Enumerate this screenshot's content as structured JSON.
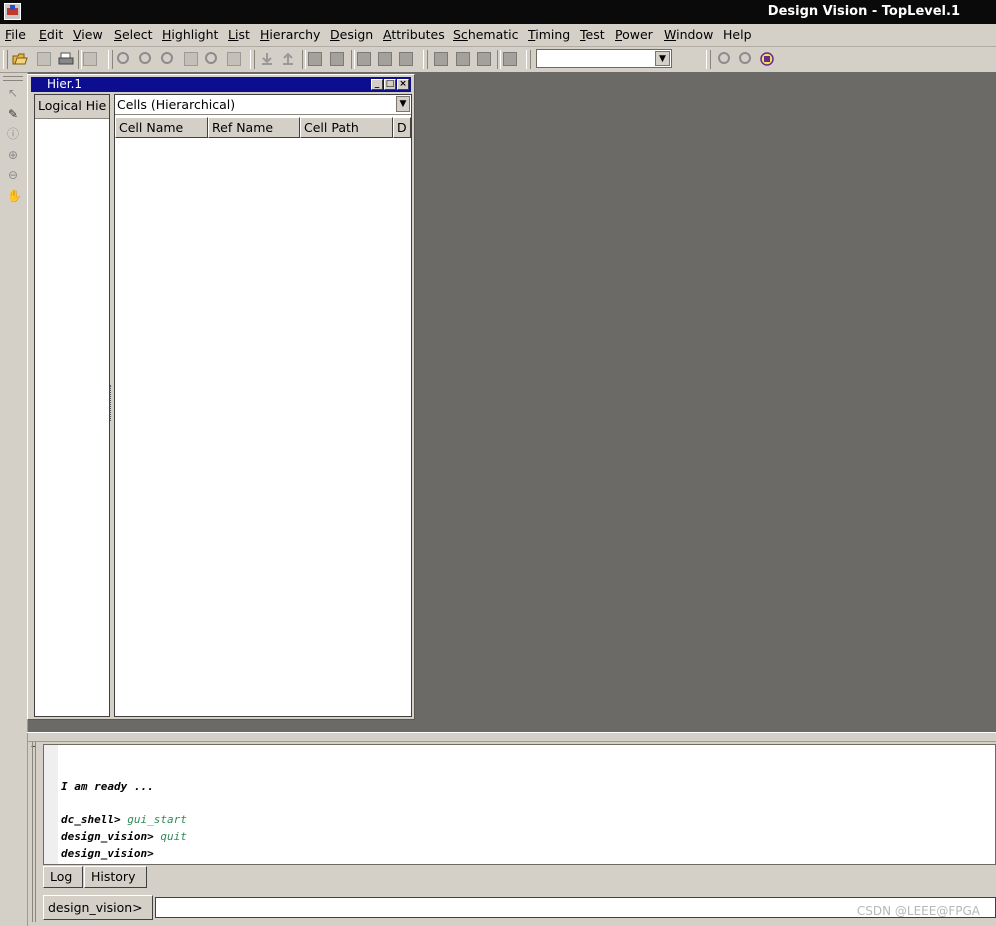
{
  "window": {
    "title": "Design Vision - TopLevel.1"
  },
  "menubar": {
    "items": [
      {
        "mn": "F",
        "rest": "ile"
      },
      {
        "mn": "E",
        "rest": "dit"
      },
      {
        "mn": "V",
        "rest": "iew"
      },
      {
        "mn": "S",
        "rest": "elect"
      },
      {
        "mn": "H",
        "rest": "ighlight"
      },
      {
        "mn": "Li",
        "rest": "st"
      },
      {
        "mn": "H",
        "rest": "ierarchy"
      },
      {
        "mn": "D",
        "rest": "esign"
      },
      {
        "mn": "A",
        "rest": "ttributes"
      },
      {
        "mn": "Sc",
        "rest": "hematic"
      },
      {
        "mn": "T",
        "rest": "iming"
      },
      {
        "mn": "T",
        "rest": "est"
      },
      {
        "mn": "P",
        "rest": "ower"
      },
      {
        "mn": "W",
        "rest": "indow"
      },
      {
        "mn": "",
        "rest": "Help"
      }
    ]
  },
  "toolbar": {
    "combo_value": ""
  },
  "hier_window": {
    "title": "Hier.1",
    "left_tab": "Logical Hie",
    "view_select": "Cells (Hierarchical)",
    "columns": [
      "Cell Name",
      "Ref Name",
      "Cell Path",
      "D"
    ]
  },
  "console": {
    "lines": [
      {
        "prompt": "I am ready ...",
        "cmd": ""
      },
      {
        "prompt": "dc_shell> ",
        "cmd": "gui_start"
      },
      {
        "prompt": "design_vision> ",
        "cmd": "quit"
      },
      {
        "prompt": "design_vision>",
        "cmd": ""
      }
    ],
    "tabs": [
      "Log",
      "History"
    ],
    "prompt_label": "design_vision>",
    "input_value": ""
  },
  "watermark": "CSDN @LEEE@FPGA",
  "colors": {
    "workspace": "#6c6a66",
    "child_title": "#0d0d90",
    "command_text": "#2e8b57"
  }
}
